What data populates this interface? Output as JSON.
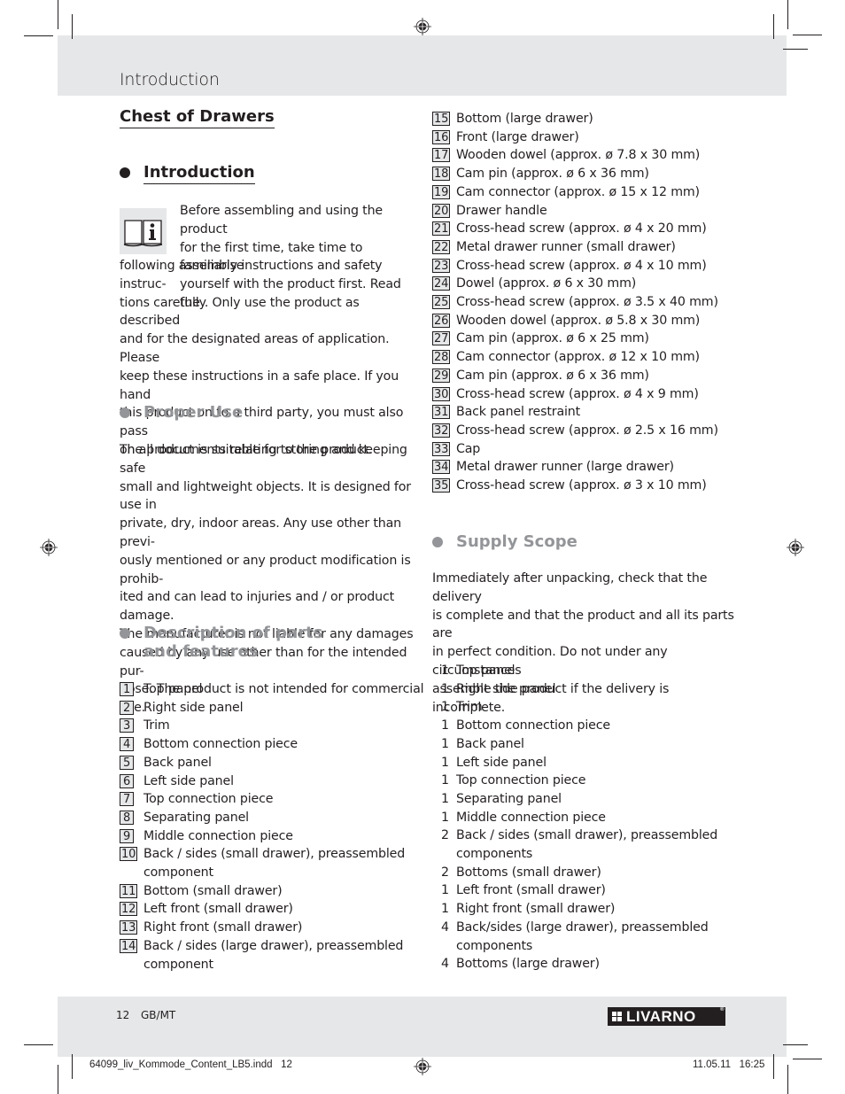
{
  "header": {
    "title": "Introduction"
  },
  "main_title": "Chest of Drawers",
  "icons": {
    "registration_mark": "crosshair-target-icon",
    "info": "book-info-icon",
    "bullet": "filled-circle-icon",
    "logo": "livarno-logo"
  },
  "colors": {
    "band_grey": "#e6e7e8",
    "heading_grey": "#939598",
    "text": "#231f20"
  },
  "introduction": {
    "heading": "Introduction",
    "lines": [
      "Before assembling and using the product",
      "for the first time, take time to familiarise",
      "yourself with the product first. Read the",
      "following assembly instructions and safety instruc-",
      "tions carefully. Only use the product as described",
      "and for the designated areas of application. Please",
      "keep these instructions in a safe place. If you hand",
      "this product on to a third party, you must also pass",
      "on all documents relating to the product."
    ]
  },
  "proper_use": {
    "heading": "Proper Use",
    "lines": [
      "The product is suitable for storing and keeping safe",
      "small and lightweight objects. It is designed for use in",
      "private, dry, indoor areas. Any use other than previ-",
      "ously mentioned or any product modification is prohib-",
      "ited and can lead to injuries and / or product damage.",
      "The manufacturer is not liable for any damages",
      "caused by any use other than for the intended pur-",
      "pose. The product is not intended for commercial use."
    ]
  },
  "description": {
    "heading_line1": "Description of parts",
    "heading_line2": "and features",
    "parts": [
      {
        "num": "1",
        "label": "Top panel"
      },
      {
        "num": "2",
        "label": "Right side panel"
      },
      {
        "num": "3",
        "label": "Trim"
      },
      {
        "num": "4",
        "label": "Bottom connection piece"
      },
      {
        "num": "5",
        "label": "Back panel"
      },
      {
        "num": "6",
        "label": "Left side panel"
      },
      {
        "num": "7",
        "label": "Top connection piece"
      },
      {
        "num": "8",
        "label": "Separating panel"
      },
      {
        "num": "9",
        "label": "Middle connection piece"
      },
      {
        "num": "10",
        "label": "Back / sides (small drawer), preassembled",
        "label2": "component"
      },
      {
        "num": "11",
        "label": "Bottom (small drawer)"
      },
      {
        "num": "12",
        "label": "Left front (small drawer)"
      },
      {
        "num": "13",
        "label": "Right front (small drawer)"
      },
      {
        "num": "14",
        "label": "Back / sides (large drawer), preassembled",
        "label2": "component"
      },
      {
        "num": "15",
        "label": "Bottom (large drawer)"
      },
      {
        "num": "16",
        "label": "Front (large drawer)"
      },
      {
        "num": "17",
        "label": "Wooden dowel (approx. ø 7.8 x 30 mm)"
      },
      {
        "num": "18",
        "label": "Cam pin (approx. ø 6 x 36 mm)"
      },
      {
        "num": "19",
        "label": "Cam connector (approx. ø 15 x 12 mm)"
      },
      {
        "num": "20",
        "label": "Drawer handle"
      },
      {
        "num": "21",
        "label": "Cross-head screw (approx. ø 4 x 20 mm)"
      },
      {
        "num": "22",
        "label": "Metal drawer runner (small drawer)"
      },
      {
        "num": "23",
        "label": "Cross-head screw (approx. ø 4 x 10 mm)"
      },
      {
        "num": "24",
        "label": "Dowel (approx. ø 6 x 30 mm)"
      },
      {
        "num": "25",
        "label": "Cross-head screw (approx. ø 3.5 x 40 mm)"
      },
      {
        "num": "26",
        "label": "Wooden dowel (approx. ø 5.8 x 30 mm)"
      },
      {
        "num": "27",
        "label": "Cam pin (approx. ø 6 x 25 mm)"
      },
      {
        "num": "28",
        "label": "Cam connector (approx. ø 12 x 10 mm)"
      },
      {
        "num": "29",
        "label": "Cam pin (approx. ø 6 x 36 mm)"
      },
      {
        "num": "30",
        "label": "Cross-head screw (approx. ø 4 x 9 mm)"
      },
      {
        "num": "31",
        "label": "Back panel restraint"
      },
      {
        "num": "32",
        "label": "Cross-head screw (approx. ø 2.5 x 16 mm)"
      },
      {
        "num": "33",
        "label": "Cap"
      },
      {
        "num": "34",
        "label": "Metal drawer runner (large drawer)"
      },
      {
        "num": "35",
        "label": "Cross-head screw (approx. ø 3 x 10 mm)"
      }
    ]
  },
  "supply_scope": {
    "heading": "Supply Scope",
    "lines": [
      "Immediately after unpacking, check that the delivery",
      "is complete and that the product and all its parts are",
      "in perfect condition. Do not under any circumstances",
      "assemble the product if the delivery is incomplete."
    ],
    "items": [
      {
        "qty": "1",
        "label": "Top panel"
      },
      {
        "qty": "1",
        "label": "Right side panel"
      },
      {
        "qty": "1",
        "label": "Trim"
      },
      {
        "qty": "1",
        "label": "Bottom connection piece"
      },
      {
        "qty": "1",
        "label": "Back panel"
      },
      {
        "qty": "1",
        "label": "Left side panel"
      },
      {
        "qty": "1",
        "label": "Top connection piece"
      },
      {
        "qty": "1",
        "label": "Separating panel"
      },
      {
        "qty": "1",
        "label": "Middle connection piece"
      },
      {
        "qty": "2",
        "label": "Back / sides (small drawer), preassembled",
        "label2": "components"
      },
      {
        "qty": "2",
        "label": "Bottoms (small drawer)"
      },
      {
        "qty": "1",
        "label": "Left front (small drawer)"
      },
      {
        "qty": "1",
        "label": "Right front (small drawer)"
      },
      {
        "qty": "4",
        "label": "Back/sides (large drawer), preassembled",
        "label2": "components"
      },
      {
        "qty": "4",
        "label": "Bottoms (large drawer)"
      }
    ]
  },
  "footer": {
    "page_number": "12",
    "language": "GB/MT",
    "brand": "LIVARNO",
    "brand_mark": "®"
  },
  "slug": {
    "file": "64099_liv_Kommode_Content_LB5.indd   12",
    "datetime": "11.05.11   16:25"
  }
}
